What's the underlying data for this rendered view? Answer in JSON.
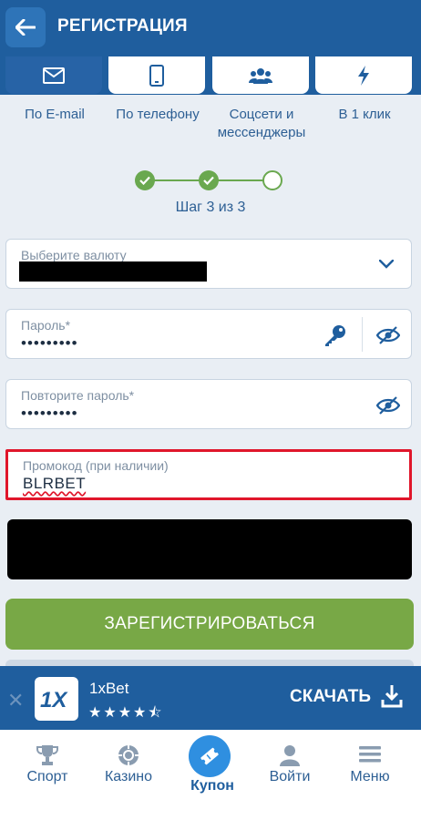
{
  "header": {
    "title": "РЕГИСТРАЦИЯ",
    "back_icon": "arrow-left-icon"
  },
  "tabs": [
    {
      "label": "По E-mail",
      "icon": "envelope-icon",
      "active": true
    },
    {
      "label": "По телефону",
      "icon": "phone-icon",
      "active": false
    },
    {
      "label": "Соцсети и мессенджеры",
      "label_line1": "Соцсети и",
      "label_line2": "мессенджеры",
      "icon": "users-icon",
      "active": false
    },
    {
      "label": "В 1 клик",
      "icon": "lightning-icon",
      "active": false
    }
  ],
  "stepper": {
    "text": "Шаг 3 из 3",
    "current": 3,
    "total": 3
  },
  "form": {
    "currency": {
      "label": "Выберите валюту"
    },
    "password": {
      "label": "Пароль*",
      "value": "•••••••••"
    },
    "password_repeat": {
      "label": "Повторите пароль*",
      "value": "•••••••••"
    },
    "promo": {
      "label": "Промокод (при наличии)",
      "value": "BLRBET"
    },
    "register_label": "ЗАРЕГИСТРИРОВАТЬСЯ"
  },
  "banner": {
    "app_name": "1xBet",
    "rating": 4.5,
    "stars": "★★★★⯪",
    "download_label": "СКАЧАТЬ",
    "logo_text": "1X"
  },
  "bottom_nav": [
    {
      "label": "Спорт",
      "icon": "trophy-icon"
    },
    {
      "label": "Казино",
      "icon": "casino-chip-icon"
    },
    {
      "label": "Купон",
      "icon": "ticket-icon",
      "active": true
    },
    {
      "label": "Войти",
      "icon": "user-icon"
    },
    {
      "label": "Меню",
      "icon": "hamburger-menu-icon"
    }
  ],
  "colors": {
    "primary": "#1f5e9e",
    "accent_green": "#78a846",
    "promo_border": "#e0162b",
    "coupon": "#2f8fe0"
  }
}
